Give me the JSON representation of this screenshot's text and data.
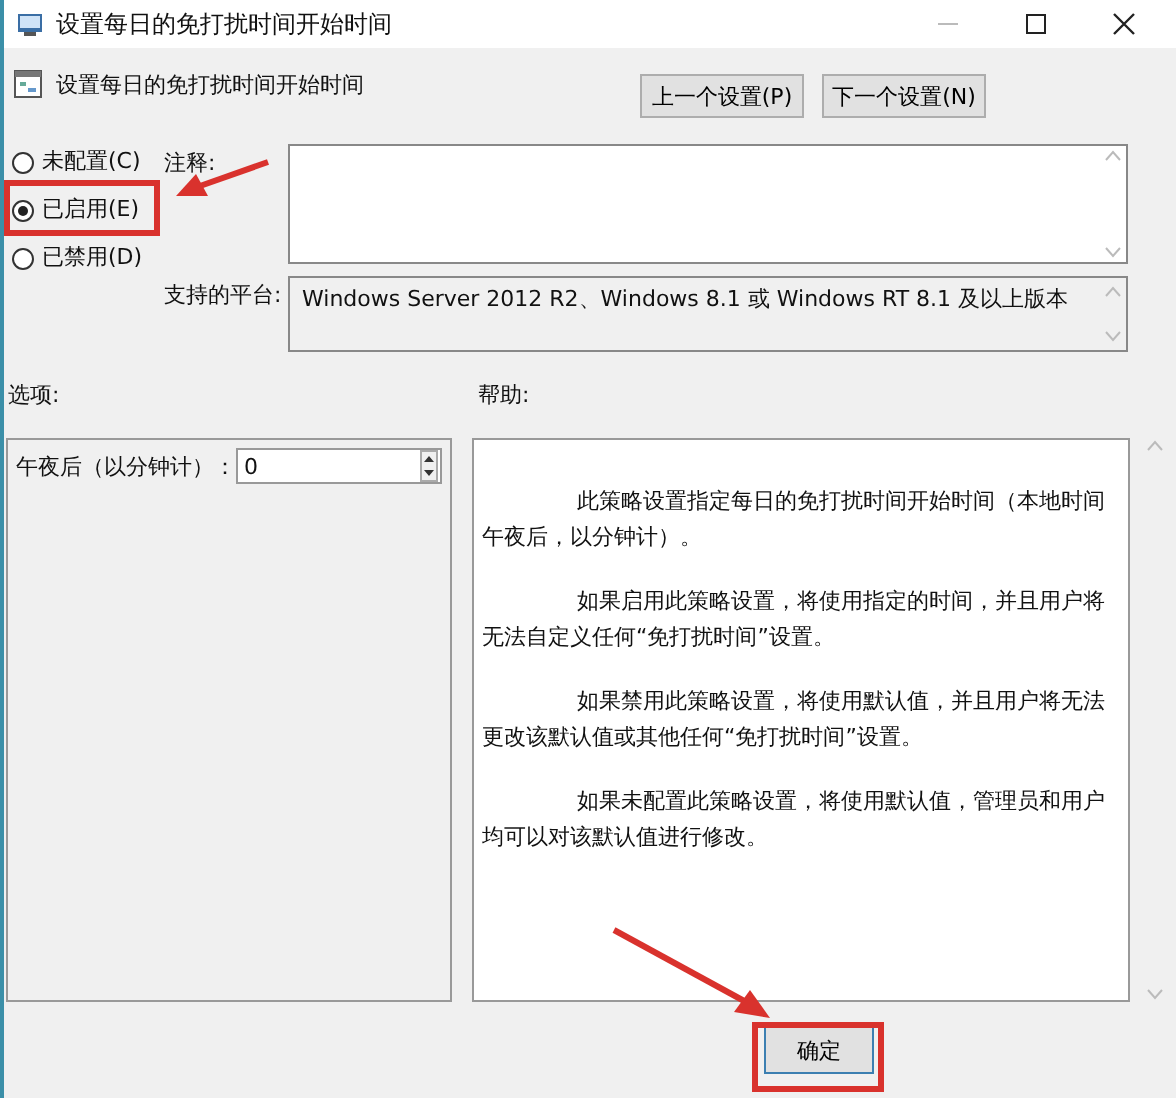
{
  "window": {
    "title": "设置每日的免打扰时间开始时间"
  },
  "header": {
    "title": "设置每日的免打扰时间开始时间",
    "buttons": [
      "上一个设置(P)",
      "下一个设置(N)"
    ]
  },
  "radios": [
    {
      "label": "未配置(C)",
      "selected": false
    },
    {
      "label": "已启用(E)",
      "selected": true
    },
    {
      "label": "已禁用(D)",
      "selected": false
    }
  ],
  "comment": {
    "label": "注释:"
  },
  "platform": {
    "label": "支持的平台:",
    "value": "Windows Server 2012 R2、Windows 8.1 或 Windows RT 8.1 及以上版本"
  },
  "options": {
    "label": "选项:",
    "fields": [
      {
        "label": "午夜后（以分钟计）：",
        "value": "0"
      }
    ]
  },
  "help": {
    "label": "帮助:",
    "paragraphs": [
      "此策略设置指定每日的免打扰时间开始时间（本地时间午夜后，以分钟计）。",
      "如果启用此策略设置，将使用指定的时间，并且用户将无法自定义任何“免打扰时间”设置。",
      "如果禁用此策略设置，将使用默认值，并且用户将无法更改该默认值或其他任何“免打扰时间”设置。",
      "如果未配置此策略设置，将使用默认值，管理员和用户均可以对该默认值进行修改。"
    ]
  },
  "buttons": [
    {
      "label": "确定"
    }
  ]
}
